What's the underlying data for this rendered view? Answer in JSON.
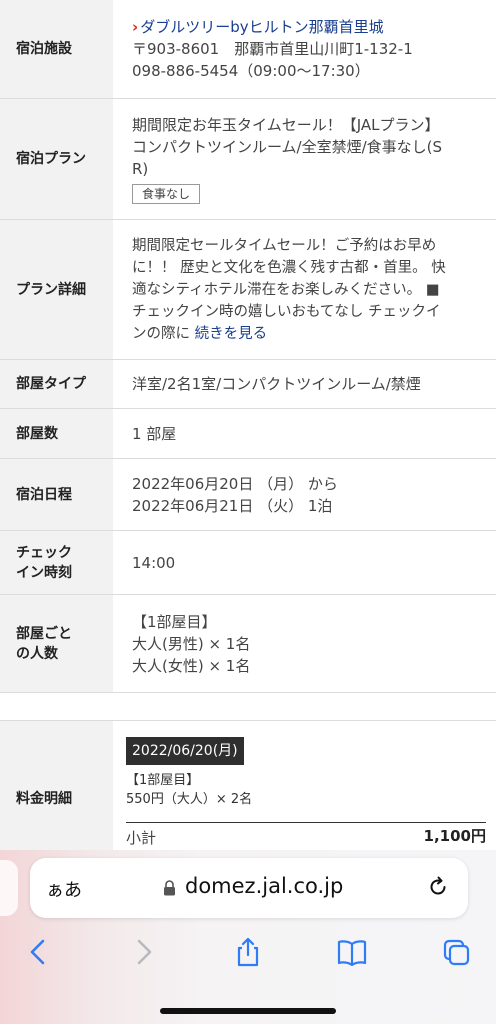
{
  "rows": [
    {
      "label": "宿泊施設",
      "hotel_name": "ダブルツリーbyヒルトン那覇首里城",
      "address": "〒903-8601　那覇市首里山川町1-132-1",
      "phone": "098-886-5454（09:00〜17:30）"
    },
    {
      "label": "宿泊プラン",
      "line1": "期間限定お年玉タイムセール！【JALプラン】",
      "line2": "コンパクトツインルーム/全室禁煙/食事なし(S",
      "line3": "R)",
      "tag": "食事なし"
    },
    {
      "label": "プラン詳細",
      "line1": "期間限定セールタイムセール！ご予約はお早め",
      "line2": "に！！ 歴史と文化を色濃く残す古都・首里。 快",
      "line3": "適なシティホテル滞在をお楽しみください。 ■",
      "line4": "チェックイン時の嬉しいおもてなし チェックイ",
      "line5_pre": "ンの際に ",
      "more_link": "続きを見る"
    },
    {
      "label": "部屋タイプ",
      "value": "洋室/2名1室/コンパクトツインルーム/禁煙"
    },
    {
      "label": "部屋数",
      "value": "1 部屋"
    },
    {
      "label": "宿泊日程",
      "line1": "2022年06月20日 （月） から",
      "line2": "2022年06月21日 （火） 1泊"
    },
    {
      "label_line1": "チェック",
      "label_line2": "イン時刻",
      "value": "14:00"
    },
    {
      "label_line1": "部屋ごと",
      "label_line2": "の人数",
      "line1": "【1部屋目】",
      "line2": "大人(男性) × 1名",
      "line3": "大人(女性) × 1名"
    },
    {
      "label": "料金明細",
      "date_chip": "2022/06/20(月)",
      "room": "【1部屋目】",
      "price_line": "550円（大人）× 2名"
    }
  ],
  "subtotal": {
    "label": "小計",
    "amount": "1,100円"
  },
  "browser": {
    "aa": "ぁあ",
    "url": "domez.jal.co.jp"
  }
}
